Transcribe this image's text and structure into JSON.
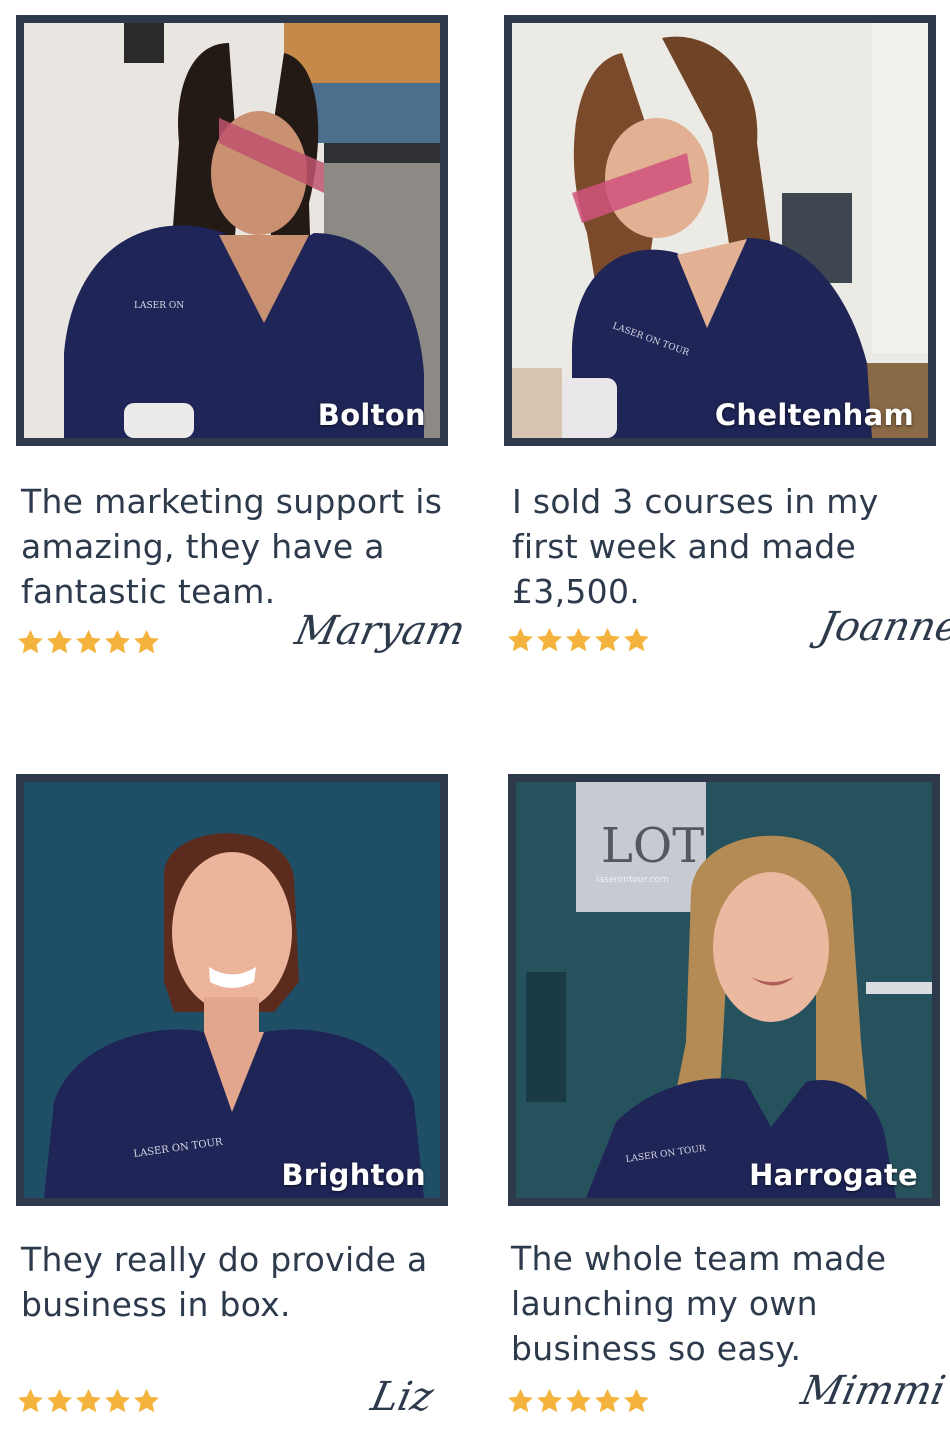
{
  "testimonials": [
    {
      "location": "Bolton",
      "quote": "The marketing support is amazing, they have a fantastic team.",
      "name": "Maryam",
      "rating": 5,
      "scrub_text": "LASER ON"
    },
    {
      "location": "Cheltenham",
      "quote": "I sold 3 courses in my first week and made £3,500.",
      "name": "Joanne",
      "rating": 5,
      "scrub_text": "LASER ON TOUR"
    },
    {
      "location": "Brighton",
      "quote": "They really do provide a business in box.",
      "name": "Liz",
      "rating": 5,
      "scrub_text": "LASER ON TOUR"
    },
    {
      "location": "Harrogate",
      "quote": "The whole team made launching my own business so easy.",
      "name": "Mimmi",
      "rating": 5,
      "scrub_text": "LASER ON TOUR",
      "wall_logo": "LOT",
      "wall_logo_url": "laserontour.com"
    }
  ],
  "colors": {
    "frame": "#2e3a4c",
    "text": "#2d3a4c",
    "star": "#f3b33d",
    "scrubs": "#1f2557"
  }
}
